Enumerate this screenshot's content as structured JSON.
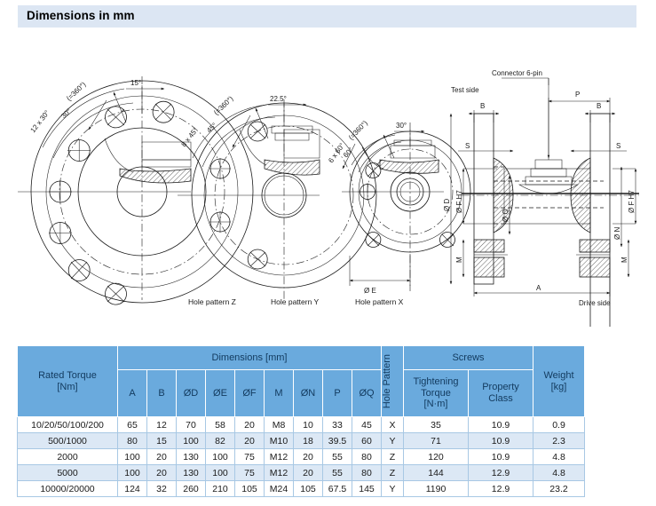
{
  "banner": {
    "title": "Dimensions in mm"
  },
  "drawings": {
    "pattern_z": {
      "label": "Hole pattern Z",
      "count_angle": "12 x 30°",
      "total": "(=360°)",
      "pitch_angle": "30°",
      "offset_angle": "15°"
    },
    "pattern_y": {
      "label": "Hole pattern Y",
      "count_angle": "8 x 45°",
      "total": "(=360°)",
      "pitch_angle": "45°",
      "offset_angle": "22.5°"
    },
    "pattern_x": {
      "label": "Hole pattern X",
      "count_angle": "6 x 60°",
      "total": "(=360°)",
      "pitch_angle": "60°",
      "offset_angle": "30°",
      "diameter_e": "Ø E"
    },
    "assembly": {
      "connector": "Connector 6-pin",
      "test_side": "Test side",
      "drive_side": "Drive side",
      "dim_p": "P",
      "dim_b_left": "B",
      "dim_b_right": "B",
      "dim_s_left": "S",
      "dim_s_right": "S",
      "dim_a": "A",
      "dim_m_left": "M",
      "dim_m_right": "M",
      "dia_d_left": "Ø D",
      "dia_f_left": "Ø F H7",
      "dia_f_right": "Ø F H7",
      "dia_q": "Ø Q",
      "dia_n": "Ø N",
      "dia_d_right": "Ø D"
    }
  },
  "table": {
    "group_headers": {
      "rated_torque": "Rated Torque\n[Nm]",
      "rated_torque_line1": "Rated Torque",
      "rated_torque_line2": "[Nm]",
      "dimensions": "Dimensions [mm]",
      "hole_pattern": "Hole Pattern",
      "screws": "Screws",
      "tightening_torque_line1": "Tightening",
      "tightening_torque_line2": "Torque",
      "tightening_torque_line3": "[N·m]",
      "property_class_line1": "Property",
      "property_class_line2": "Class",
      "weight_line1": "Weight",
      "weight_line2": "[kg]"
    },
    "dimension_columns": [
      "A",
      "B",
      "ØD",
      "ØE",
      "ØF",
      "M",
      "ØN",
      "P",
      "ØQ"
    ],
    "rows": [
      {
        "rated_torque": "10/20/50/100/200",
        "A": "65",
        "B": "12",
        "OD": "70",
        "OE": "58",
        "OF": "20",
        "M": "M8",
        "ON": "10",
        "P": "33",
        "OQ": "45",
        "hole_pattern": "X",
        "tightening_torque": "35",
        "property_class": "10.9",
        "weight": "0.9"
      },
      {
        "rated_torque": "500/1000",
        "A": "80",
        "B": "15",
        "OD": "100",
        "OE": "82",
        "OF": "20",
        "M": "M10",
        "ON": "18",
        "P": "39.5",
        "OQ": "60",
        "hole_pattern": "Y",
        "tightening_torque": "71",
        "property_class": "10.9",
        "weight": "2.3"
      },
      {
        "rated_torque": "2000",
        "A": "100",
        "B": "20",
        "OD": "130",
        "OE": "100",
        "OF": "75",
        "M": "M12",
        "ON": "20",
        "P": "55",
        "OQ": "80",
        "hole_pattern": "Z",
        "tightening_torque": "120",
        "property_class": "10.9",
        "weight": "4.8"
      },
      {
        "rated_torque": "5000",
        "A": "100",
        "B": "20",
        "OD": "130",
        "OE": "100",
        "OF": "75",
        "M": "M12",
        "ON": "20",
        "P": "55",
        "OQ": "80",
        "hole_pattern": "Z",
        "tightening_torque": "144",
        "property_class": "12.9",
        "weight": "4.8"
      },
      {
        "rated_torque": "10000/20000",
        "A": "124",
        "B": "32",
        "OD": "260",
        "OE": "210",
        "OF": "105",
        "M": "M24",
        "ON": "105",
        "P": "67.5",
        "OQ": "145",
        "hole_pattern": "Y",
        "tightening_torque": "1190",
        "property_class": "12.9",
        "weight": "23.2"
      }
    ]
  },
  "colors": {
    "banner_bg": "#dce6f3",
    "table_header_bg": "#6aaadd",
    "table_row_alt_bg": "#dce8f5",
    "table_border": "#a8c8e4",
    "line": "#1a1a1a"
  }
}
